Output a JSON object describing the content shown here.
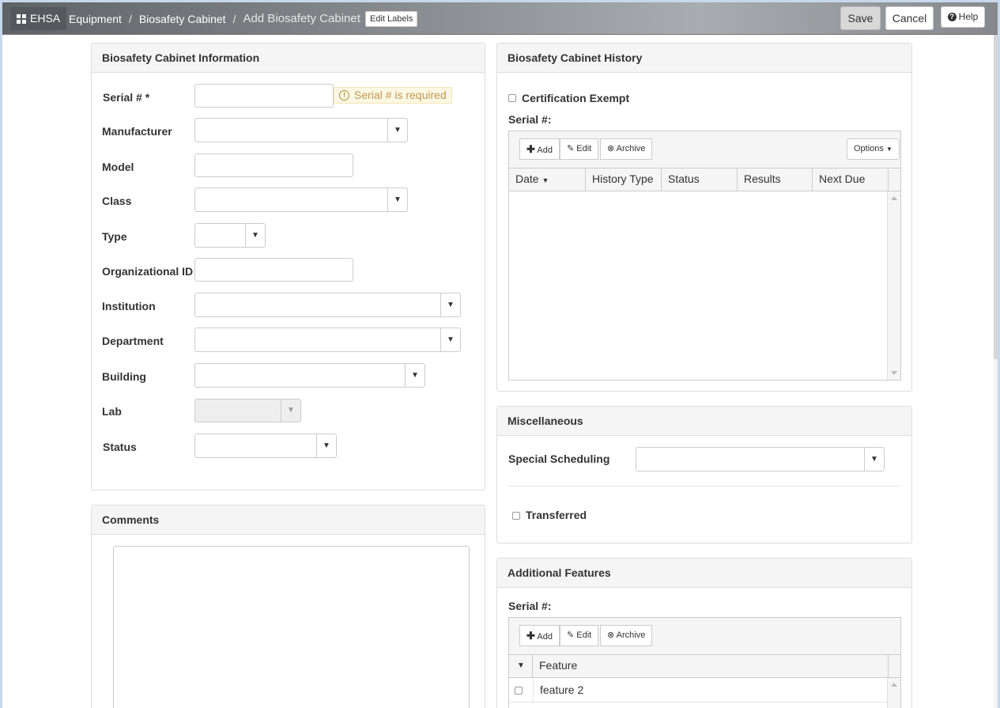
{
  "topbar": {
    "brand": "EHSA",
    "breadcrumbs": [
      "Equipment",
      "Biosafety Cabinet",
      "Add Biosafety Cabinet"
    ],
    "edit_labels": "Edit Labels",
    "save": "Save",
    "cancel": "Cancel",
    "help": "Help"
  },
  "info_panel": {
    "title": "Biosafety Cabinet Information",
    "fields": {
      "serial": "Serial # *",
      "manufacturer": "Manufacturer",
      "model": "Model",
      "class": "Class",
      "type": "Type",
      "org_id": "Organizational ID",
      "institution": "Institution",
      "department": "Department",
      "building": "Building",
      "lab": "Lab",
      "status": "Status"
    },
    "serial_error": "Serial # is required"
  },
  "comments_panel": {
    "title": "Comments"
  },
  "history_panel": {
    "title": "Biosafety Cabinet History",
    "cert_exempt": "Certification Exempt",
    "serial_label": "Serial #:",
    "toolbar": {
      "add": "Add",
      "edit": "Edit",
      "archive": "Archive",
      "options": "Options"
    },
    "columns": [
      "Date",
      "History Type",
      "Status",
      "Results",
      "Next Due"
    ]
  },
  "misc_panel": {
    "title": "Miscellaneous",
    "special_scheduling": "Special Scheduling",
    "transferred": "Transferred"
  },
  "features_panel": {
    "title": "Additional Features",
    "serial_label": "Serial #:",
    "toolbar": {
      "add": "Add",
      "edit": "Edit",
      "archive": "Archive"
    },
    "column": "Feature",
    "rows": [
      "feature 2"
    ]
  }
}
